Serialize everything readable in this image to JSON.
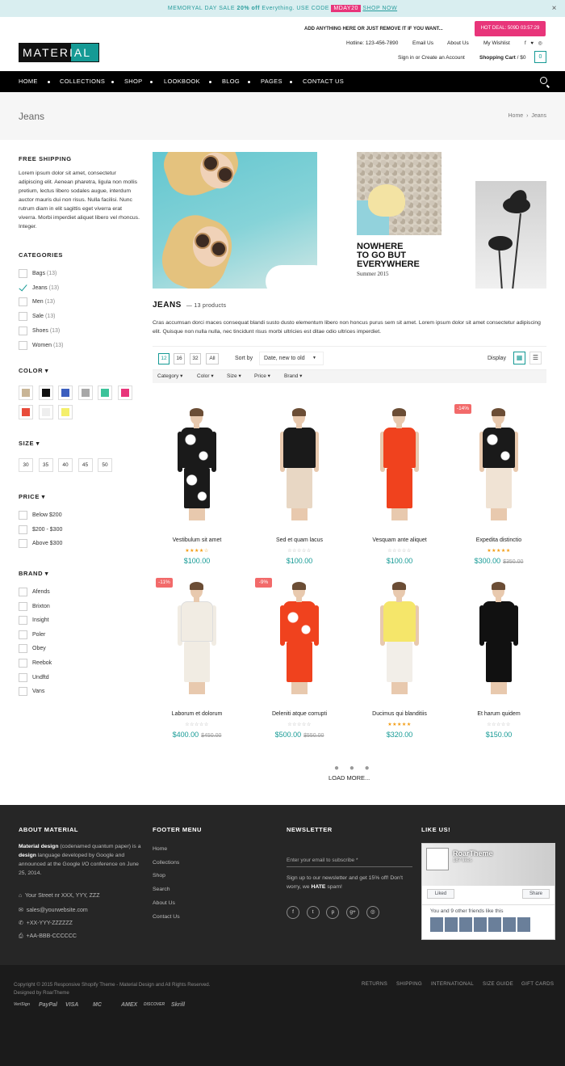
{
  "promo": {
    "text1": "MEMORYAL DAY SALE ",
    "bold": "20% off",
    "text2": " Everything. USE CODE ",
    "code": "MDAY20",
    "shop": "SHOP NOW",
    "close": "×"
  },
  "header": {
    "note": "ADD ANYTHING HERE OR JUST REMOVE IT IF YOU WANT...",
    "deal": "HOT DEAL: 509D 03:57:29",
    "logo": "MATERIAL",
    "hotline": "Hotline: 123-456-7890",
    "email": "Email Us",
    "about": "About Us",
    "wishlist": "My Wishlist",
    "social": "f ♥ ◎",
    "signin": "Sign in or Create an Account",
    "cart_label": "Shopping Cart",
    "cart_total": "/ $0",
    "cart_count": "0"
  },
  "nav": [
    "HOME",
    "COLLECTIONS",
    "SHOP",
    "LOOKBOOK",
    "BLOG",
    "PAGES",
    "CONTACT US"
  ],
  "title": {
    "page": "Jeans",
    "bc_home": "Home",
    "bc_sep": "›",
    "bc_current": "Jeans"
  },
  "sidebar": {
    "shipping_title": "FREE SHIPPING",
    "shipping_text": "Lorem ipsum dolor sit amet, consectetur adipiscing elit. Aenean pharetra, ligula non mollis pretium, lectus libero sodales augue, interdum auctor mauris dui non risus. Nulla facilisi. Nunc rutrum diam in elit sagittis eget viverra erat viverra. Morbi imperdiet aliquet libero vel rhoncus. Integer.",
    "cat_title": "CATEGORIES",
    "categories": [
      {
        "name": "Bags",
        "count": "(13)"
      },
      {
        "name": "Jeans",
        "count": "(13)"
      },
      {
        "name": "Men",
        "count": "(13)"
      },
      {
        "name": "Sale",
        "count": "(13)"
      },
      {
        "name": "Shoes",
        "count": "(13)"
      },
      {
        "name": "Women",
        "count": "(13)"
      }
    ],
    "color_title": "COLOR ▾",
    "colors": [
      "#c9b596",
      "#111111",
      "#3c5fbf",
      "#a8a8a8",
      "#3cc39a",
      "#e8357a",
      "#e84b3a",
      "#eeeeee",
      "#f4ef6a"
    ],
    "size_title": "SIZE ▾",
    "sizes": [
      "30",
      "35",
      "40",
      "45",
      "50"
    ],
    "price_title": "PRICE ▾",
    "prices": [
      "Below $200",
      "$200 - $300",
      "Above $300"
    ],
    "brand_title": "BRAND ▾",
    "brands": [
      "Afends",
      "Brixton",
      "Insight",
      "Poler",
      "Obey",
      "Reebok",
      "Undftd",
      "Vans"
    ]
  },
  "banner": {
    "line1": "NOWHERE",
    "line2": "TO GO BUT",
    "line3": "EVERYWHERE",
    "small": "Summer 2015"
  },
  "collection": {
    "title": "JEANS",
    "count": "— 13 products",
    "desc": "Cras accumsan dorci maces consequat blandi susto dusto elementum libero non honcus purus sem sit amet. Lorem ipsum dolor sit amet consectetur adipiscing elit. Quisque non nulla nulla, nec tincidunt risus morbi ultricies est ditae odio ultrices imperdiet."
  },
  "toolbar": {
    "pages": [
      "12",
      "16",
      "32",
      "All"
    ],
    "sort_label": "Sort by",
    "sort_value": "Date, new to old",
    "display": "Display",
    "grid_icon": "▦",
    "list_icon": "☰"
  },
  "filters": [
    "Category ▾",
    "Color ▾",
    "Size ▾",
    "Price ▾",
    "Brand ▾"
  ],
  "products": [
    {
      "name": "Vestibulum sit amet",
      "stars": "★★★★☆",
      "price": "$100.00",
      "old": "",
      "sale": "",
      "top": "#1a1a1a",
      "bot": "#f0f0f0",
      "arms": "#1a1a1a",
      "pattern": "bw"
    },
    {
      "name": "Sed et quam lacus",
      "stars": "☆☆☆☆☆",
      "price": "$100.00",
      "old": "",
      "sale": "",
      "top": "#1a1a1a",
      "bot": "#e8d7c4",
      "arms": "#e8c9ae",
      "pattern": "none"
    },
    {
      "name": "Vesquam ante aliquet",
      "stars": "☆☆☆☆☆",
      "price": "$100.00",
      "old": "",
      "sale": "",
      "top": "#f0421e",
      "bot": "#f0421e",
      "arms": "#e8c9ae",
      "pattern": "none"
    },
    {
      "name": "Expedita distinctio",
      "stars": "★★★★★",
      "price": "$300.00",
      "old": "$350.00",
      "sale": "-14%",
      "top": "#1a1a1a",
      "bot": "#f0e3d4",
      "arms": "#e8c9ae",
      "pattern": "bw"
    },
    {
      "name": "Laborum et dolorum",
      "stars": "☆☆☆☆☆",
      "price": "$400.00",
      "old": "$450.00",
      "sale": "-11%",
      "top": "#f1ece3",
      "bot": "#f1ece3",
      "arms": "#f1ece3",
      "pattern": "none"
    },
    {
      "name": "Deleniti atque corrupti",
      "stars": "☆☆☆☆☆",
      "price": "$500.00",
      "old": "$550.00",
      "sale": "-9%",
      "top": "#f0421e",
      "bot": "#f0421e",
      "arms": "#f0421e",
      "pattern": "rw"
    },
    {
      "name": "Ducimus qui blanditiis",
      "stars": "★★★★★",
      "price": "$320.00",
      "old": "",
      "sale": "",
      "top": "#f5e66a",
      "bot": "#f2eee8",
      "arms": "#e8c9ae",
      "pattern": "none"
    },
    {
      "name": "Et harum quidem",
      "stars": "☆☆☆☆☆",
      "price": "$150.00",
      "old": "",
      "sale": "",
      "top": "#111111",
      "bot": "#111111",
      "arms": "#111111",
      "pattern": "none"
    }
  ],
  "loadmore": {
    "dots": "● ● ●",
    "label": "LOAD MORE..."
  },
  "footer": {
    "about_title": "ABOUT MATERIAL",
    "about_b1": "Material design",
    "about_t1": " (codenamed quantum paper) is a ",
    "about_b2": "design",
    "about_t2": " language developed by Google and announced at the Google I/O conference on June 25, 2014.",
    "address": "Your Street nr XXX, YYY, ZZZ",
    "email": "sales@yourwebsite.com",
    "phone": "+XX-YYY-ZZZZZZ",
    "fax": "+AA-BBB-CCCCCC",
    "menu_title": "FOOTER MENU",
    "menu": [
      "Home",
      "Collections",
      "Shop",
      "Search",
      "About Us",
      "Contact Us"
    ],
    "news_title": "NEWSLETTER",
    "news_placeholder": "Enter your email to subscribe *",
    "news_text1": "Sign up to our newsletter and get 15% off! Don't worry, we ",
    "news_hate": "HATE",
    "news_text2": " spam!",
    "social": [
      "f",
      "t",
      "p",
      "g+",
      "◎"
    ],
    "like_title": "LIKE US!",
    "fb_name": "RoarTheme",
    "fb_likes": "187 likes",
    "fb_liked": "Liked",
    "fb_share": "Share",
    "fb_friends": "You and 9 other friends like this"
  },
  "bottom": {
    "copy1": "Copyright © 2015 Responsive Shopify Theme - Material Design and All Rights Reserved.",
    "copy2": "Designed by RoarTheme",
    "links": [
      "RETURNS",
      "SHIPPING",
      "INTERNATIONAL",
      "SIZE GUIDE",
      "GIFT CARDS"
    ],
    "payments": [
      "VeriSign",
      "PayPal",
      "VISA",
      "MC",
      "AMEX",
      "DISCOVER",
      "Skrill"
    ]
  }
}
